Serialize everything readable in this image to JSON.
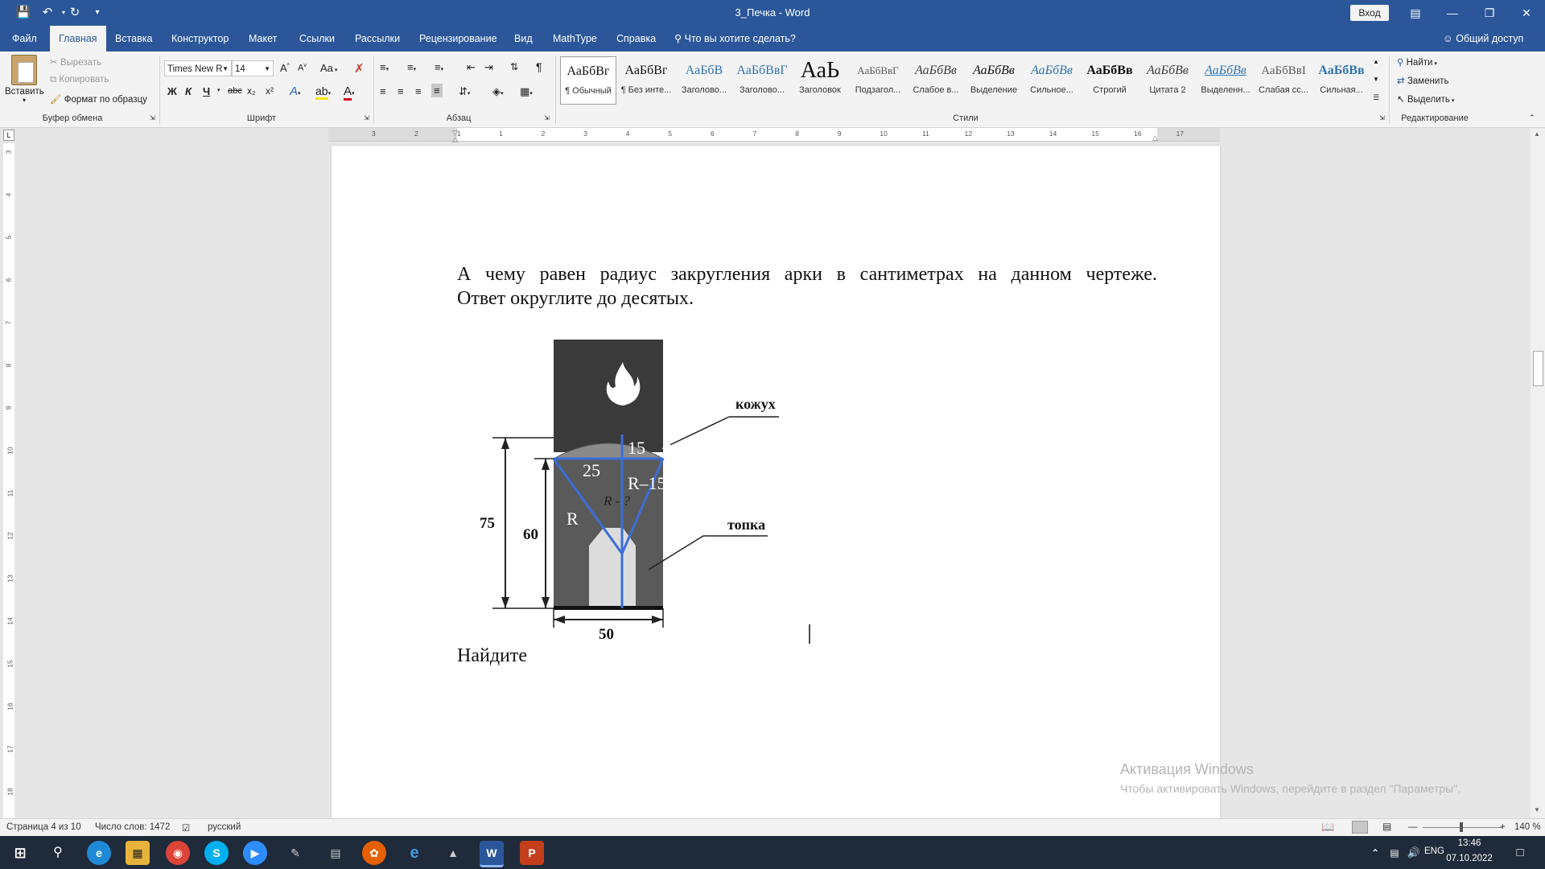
{
  "titlebar": {
    "doc_title": "3_Печка  -  Word",
    "login": "Вход"
  },
  "tabs": {
    "items": [
      "Файл",
      "Главная",
      "Вставка",
      "Конструктор",
      "Макет",
      "Ссылки",
      "Рассылки",
      "Рецензирование",
      "Вид",
      "MathType",
      "Справка"
    ],
    "active": "Главная",
    "tell_me": "Что вы хотите сделать?",
    "share": "Общий доступ"
  },
  "ribbon": {
    "clipboard": {
      "paste": "Вставить",
      "cut": "Вырезать",
      "copy": "Копировать",
      "format_painter": "Формат по образцу",
      "label": "Буфер обмена"
    },
    "font": {
      "name": "Times New R",
      "size": "14",
      "aa": "Aa",
      "bold": "Ж",
      "italic": "К",
      "underline": "Ч",
      "strike": "abc",
      "sub": "x₂",
      "sup": "x²",
      "label": "Шрифт"
    },
    "paragraph": {
      "label": "Абзац"
    },
    "styles": {
      "label": "Стили",
      "items": [
        {
          "preview": "АаБбВг",
          "name": "¶ Обычный"
        },
        {
          "preview": "АаБбВг",
          "name": "¶ Без инте..."
        },
        {
          "preview": "АаБбВ",
          "name": "Заголово..."
        },
        {
          "preview": "АаБбВвГ",
          "name": "Заголово..."
        },
        {
          "preview": "АаЬ",
          "name": "Заголовок"
        },
        {
          "preview": "АаБбВвГ",
          "name": "Подзагол..."
        },
        {
          "preview": "АаБбВв",
          "name": "Слабое в..."
        },
        {
          "preview": "АаБбВв",
          "name": "Выделение"
        },
        {
          "preview": "АаБбВв",
          "name": "Сильное..."
        },
        {
          "preview": "АаБбВв",
          "name": "Строгий"
        },
        {
          "preview": "АаБбВв",
          "name": "Цитата 2"
        },
        {
          "preview": "АаБбВв",
          "name": "Выделенн..."
        },
        {
          "preview": "АаБбВвІ",
          "name": "Слабая сс..."
        },
        {
          "preview": "АаБбВв",
          "name": "Сильная..."
        }
      ]
    },
    "editing": {
      "find": "Найти",
      "replace": "Заменить",
      "select": "Выделить",
      "label": "Редактирование"
    }
  },
  "ruler": {
    "h_numbers": [
      "3",
      "2",
      "1",
      "1",
      "2",
      "3",
      "4",
      "5",
      "6",
      "7",
      "8",
      "9",
      "10",
      "11",
      "12",
      "13",
      "14",
      "15",
      "16",
      "17"
    ],
    "v_numbers": [
      "3",
      "4",
      "5",
      "6",
      "7",
      "8",
      "9",
      "10",
      "11",
      "12",
      "13",
      "14",
      "15",
      "16",
      "17",
      "18"
    ]
  },
  "document": {
    "question_line1": "А чему равен радиус закругления арки в сантиметрах на данном чертеже.",
    "question_line2": "Ответ округлите до десятых.",
    "figure": {
      "label_kozhukh": "кожух",
      "label_topka": "топка",
      "dim_75": "75",
      "dim_60": "60",
      "dim_50": "50",
      "label_15": "15",
      "label_25": "25",
      "label_r15": "R–15",
      "label_r": "R",
      "label_rq": "R - ?"
    },
    "find_line": "Найдите"
  },
  "watermark": {
    "line1": "Активация Windows",
    "line2": "Чтобы активировать Windows, перейдите в раздел \"Параметры\"."
  },
  "statusbar": {
    "page": "Страница 4 из 10",
    "words": "Число слов: 1472",
    "lang": "русский",
    "zoom": "140 %"
  },
  "taskbar": {
    "lang": "ENG",
    "time": "13:46",
    "date": "07.10.2022"
  }
}
